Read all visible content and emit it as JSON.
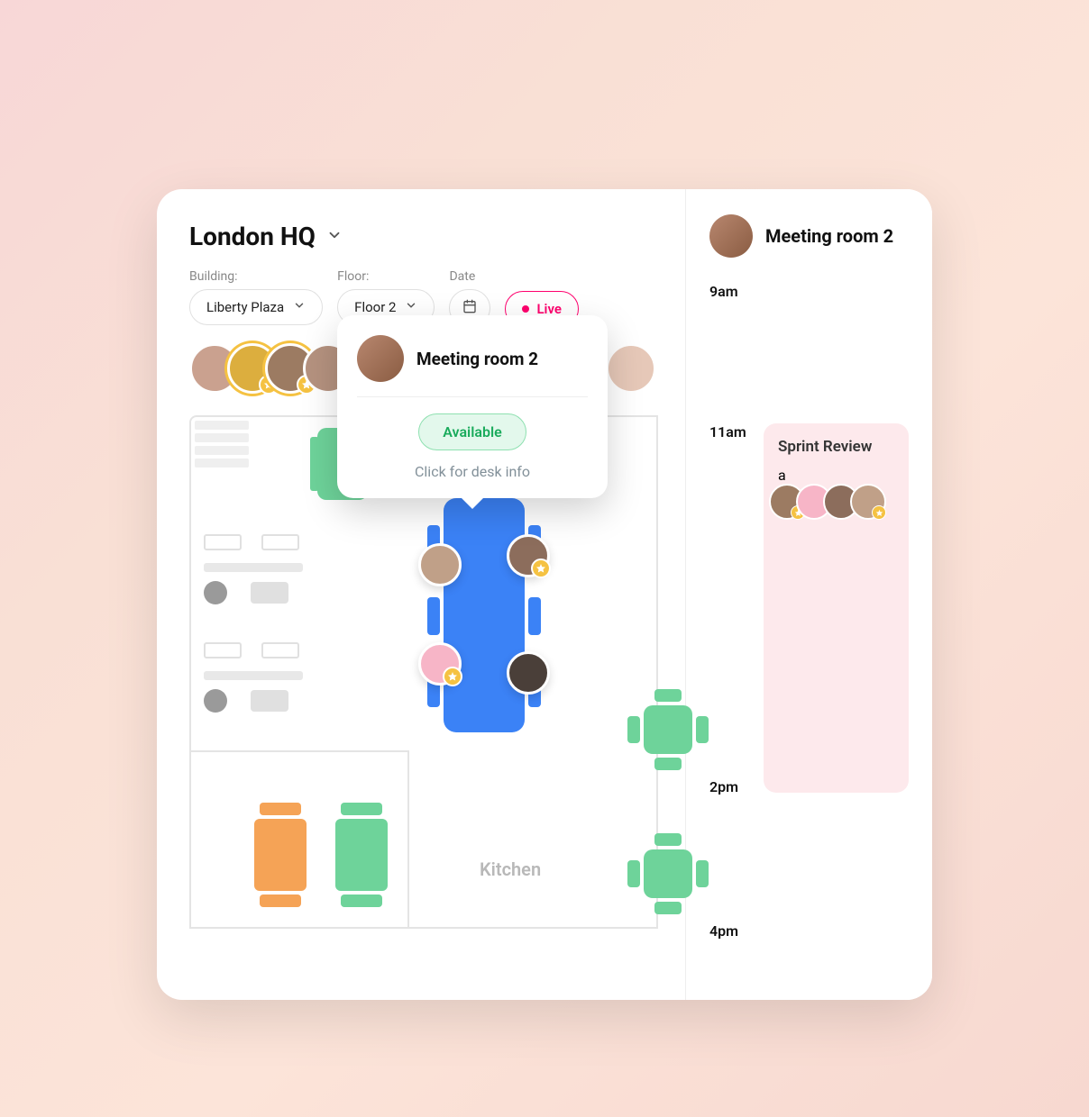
{
  "header": {
    "location_title": "London HQ"
  },
  "filters": {
    "building_label": "Building:",
    "building_value": "Liberty Plaza",
    "floor_label": "Floor:",
    "floor_value": "Floor 2",
    "date_label": "Date",
    "live_label": "Live"
  },
  "floorplan": {
    "kitchen_label": "Kitchen"
  },
  "popover": {
    "title": "Meeting room 2",
    "status": "Available",
    "hint": "Click for desk info"
  },
  "side": {
    "title": "Meeting room 2",
    "times": {
      "t1": "9am",
      "t2": "11am",
      "t3": "2pm",
      "t4": "4pm"
    },
    "event1": {
      "title": "Sprint Review"
    }
  }
}
